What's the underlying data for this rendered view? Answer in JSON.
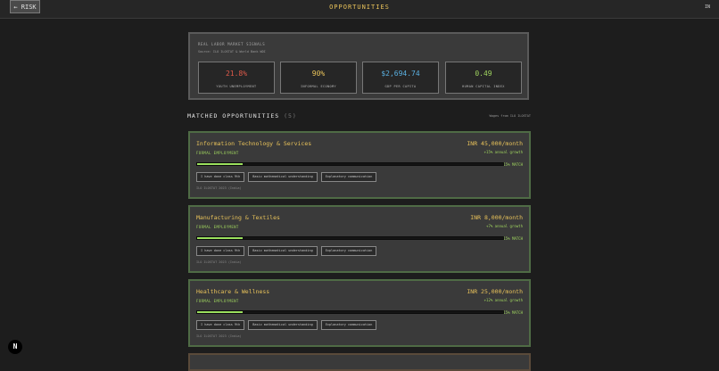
{
  "header": {
    "back_label": "← RISK",
    "title": "OPPORTUNITIES",
    "country_code": "IN"
  },
  "signals": {
    "title": "REAL LABOR MARKET SIGNALS",
    "subtitle": "Source: ILO ILOSTAT & World Bank WDI",
    "stats": [
      {
        "value": "21.8%",
        "label": "YOUTH UNEMPLOYMENT",
        "color": "#e05a4a"
      },
      {
        "value": "90%",
        "label": "INFORMAL ECONOMY",
        "color": "#e8c25a"
      },
      {
        "value": "$2,694.74",
        "label": "GDP PER CAPITA",
        "color": "#5ab0e0"
      },
      {
        "value": "0.49",
        "label": "HUMAN CAPITAL INDEX",
        "color": "#9ed25e"
      }
    ]
  },
  "section": {
    "title": "MATCHED OPPORTUNITIES",
    "count": "(5)",
    "note": "Wages from ILO ILOSTAT"
  },
  "cards": [
    {
      "title": "Information Technology & Services",
      "type": "FORMAL EMPLOYMENT",
      "salary": "INR 45,000/month",
      "growth": "+15% annual growth",
      "match": "15% MATCH",
      "match_fraction": 0.15,
      "chips": [
        "I have done class 9th",
        "Basic mathematical understanding",
        "Explanatory communication"
      ],
      "source": "ILO ILOSTAT 2023 (India)"
    },
    {
      "title": "Manufacturing & Textiles",
      "type": "FORMAL EMPLOYMENT",
      "salary": "INR 8,000/month",
      "growth": "+7% annual growth",
      "match": "15% MATCH",
      "match_fraction": 0.15,
      "chips": [
        "I have done class 9th",
        "Basic mathematical understanding",
        "Explanatory communication"
      ],
      "source": "ILO ILOSTAT 2023 (India)"
    },
    {
      "title": "Healthcare & Wellness",
      "type": "FORMAL EMPLOYMENT",
      "salary": "INR 25,000/month",
      "growth": "+12% annual growth",
      "match": "15% MATCH",
      "match_fraction": 0.15,
      "chips": [
        "I have done class 9th",
        "Basic mathematical understanding",
        "Explanatory communication"
      ],
      "source": "ILO ILOSTAT 2023 (India)"
    }
  ],
  "badge": {
    "label": "N"
  }
}
